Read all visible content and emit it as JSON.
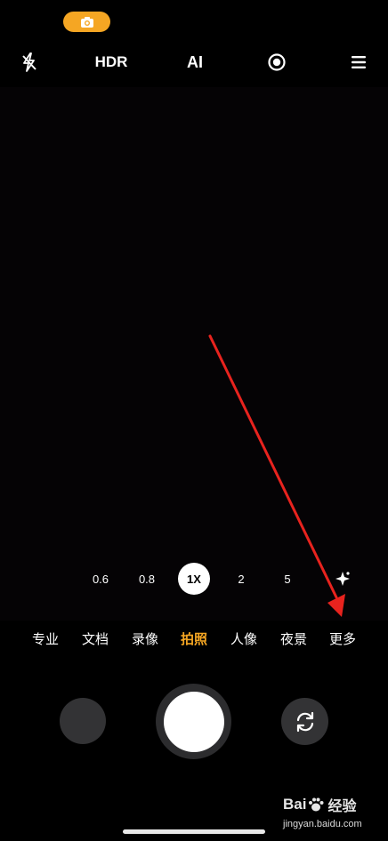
{
  "status": {
    "pill_color": "#f5a623",
    "icon": "camera-icon"
  },
  "top_bar": {
    "flash_icon": "flash-off-icon",
    "hdr_label": "HDR",
    "ai_label": "AI",
    "live_icon": "live-photo-icon",
    "menu_icon": "menu-icon"
  },
  "zoom": {
    "levels": [
      "0.6",
      "0.8",
      "1X",
      "2",
      "5"
    ],
    "selected": "1X",
    "extra_icon": "sparkle-icon"
  },
  "modes": {
    "items": [
      "专业",
      "文档",
      "录像",
      "拍照",
      "人像",
      "夜景",
      "更多"
    ],
    "selected": "拍照",
    "accent_color": "#f5a623"
  },
  "controls": {
    "gallery": "gallery-thumbnail",
    "shutter": "shutter-button",
    "switch_icon": "switch-camera-icon"
  },
  "watermark": {
    "logo_prefix": "Bai",
    "logo_suffix": "经验",
    "url": "jingyan.baidu.com"
  },
  "annotation": {
    "arrow_color": "#e8231e"
  }
}
